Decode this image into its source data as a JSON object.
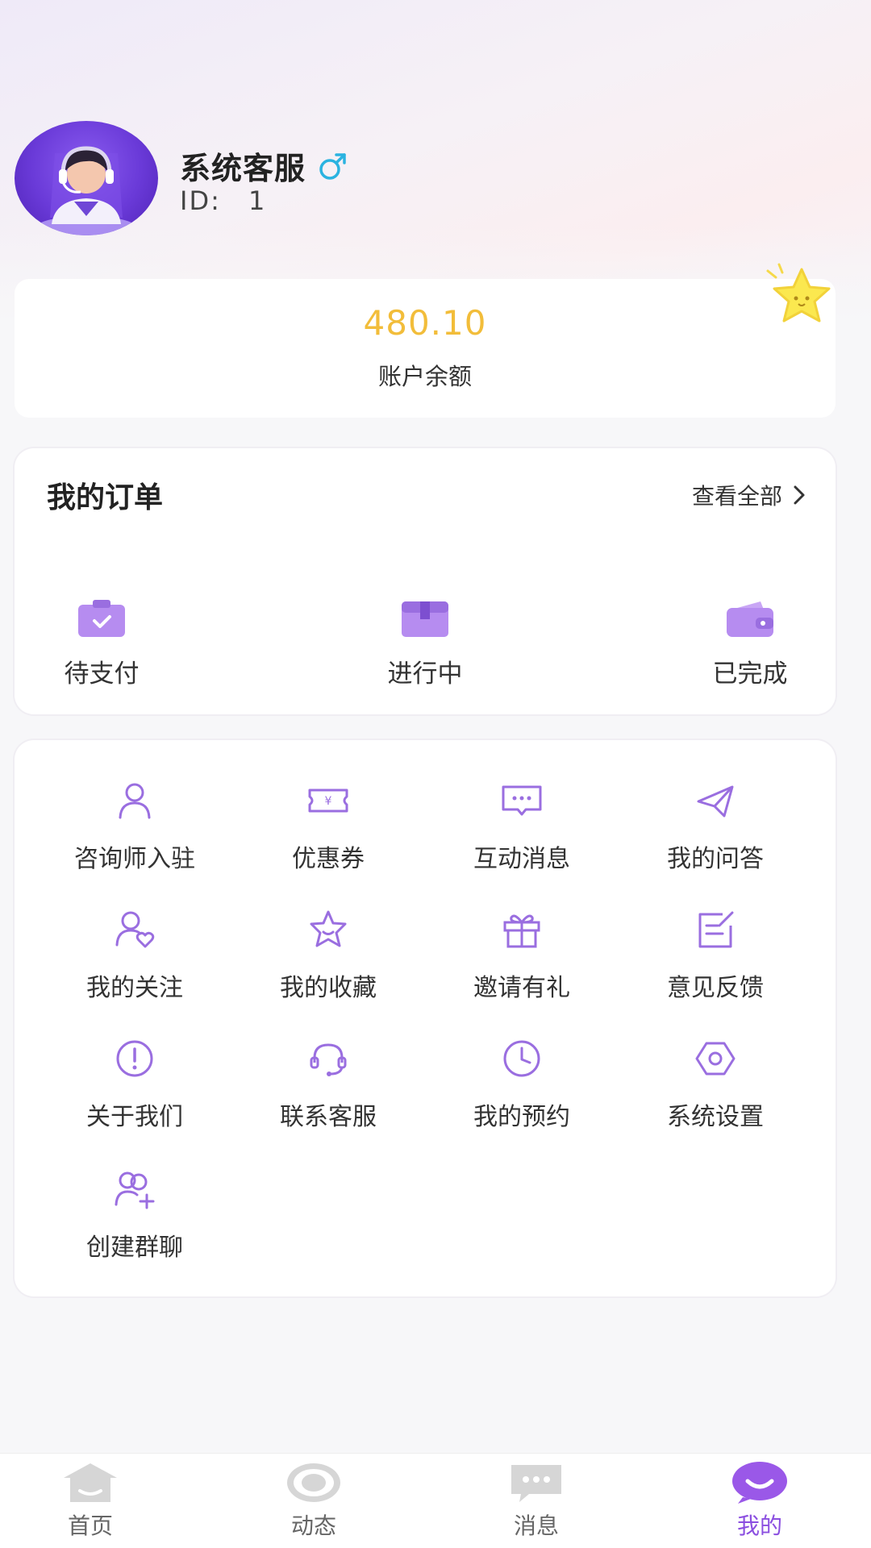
{
  "profile": {
    "name": "系统客服",
    "id_label": "ID:",
    "id_value": "1",
    "gender_icon": "male-icon"
  },
  "balance": {
    "value": "480.10",
    "label": "账户余额"
  },
  "orders": {
    "title": "我的订单",
    "view_all": "查看全部",
    "items": [
      {
        "label": "待支付",
        "icon": "clipboard-check-icon"
      },
      {
        "label": "进行中",
        "icon": "package-box-icon"
      },
      {
        "label": "已完成",
        "icon": "wallet-icon"
      }
    ]
  },
  "menu": {
    "items": [
      {
        "label": "咨询师入驻",
        "icon": "person-icon"
      },
      {
        "label": "优惠券",
        "icon": "coupon-icon"
      },
      {
        "label": "互动消息",
        "icon": "chat-bubble-icon"
      },
      {
        "label": "我的问答",
        "icon": "paper-plane-icon"
      },
      {
        "label": "我的关注",
        "icon": "person-heart-icon"
      },
      {
        "label": "我的收藏",
        "icon": "star-icon"
      },
      {
        "label": "邀请有礼",
        "icon": "gift-icon"
      },
      {
        "label": "意见反馈",
        "icon": "edit-note-icon"
      },
      {
        "label": "关于我们",
        "icon": "info-circle-icon"
      },
      {
        "label": "联系客服",
        "icon": "headset-icon"
      },
      {
        "label": "我的预约",
        "icon": "clock-icon"
      },
      {
        "label": "系统设置",
        "icon": "settings-hexagon-icon"
      },
      {
        "label": "创建群聊",
        "icon": "group-add-icon"
      }
    ]
  },
  "tabbar": {
    "items": [
      {
        "label": "首页",
        "icon": "home-icon"
      },
      {
        "label": "动态",
        "icon": "eye-icon"
      },
      {
        "label": "消息",
        "icon": "message-icon"
      },
      {
        "label": "我的",
        "icon": "profile-smile-icon"
      }
    ],
    "active_index": 3
  },
  "colors": {
    "accent": "#8b4fe0",
    "balance": "#f2bd3a",
    "icon_purple": "#9a6ee0",
    "gender": "#2bb3e0"
  }
}
